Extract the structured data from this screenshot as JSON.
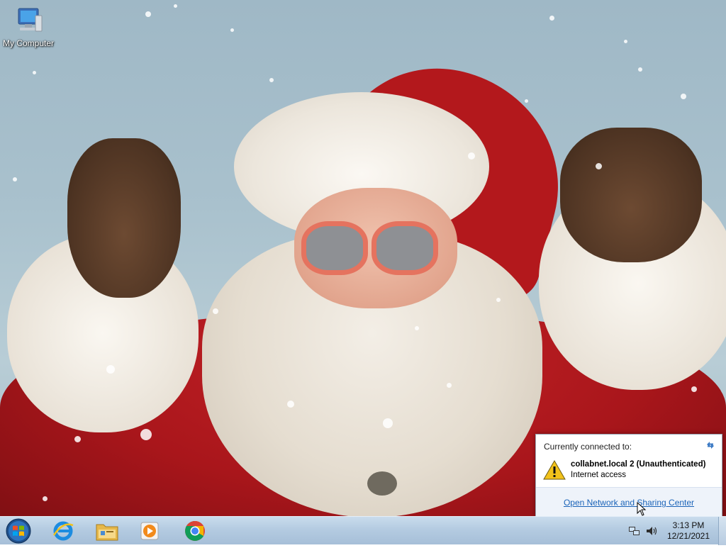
{
  "desktop": {
    "icons": [
      {
        "label": "My Computer",
        "icon": "my-computer-icon"
      }
    ],
    "wallpaper": "santa-claus-rock-gesture-snow"
  },
  "taskbar": {
    "start": {
      "icon": "windows-start-orb"
    },
    "pinned": [
      {
        "name": "Internet Explorer",
        "icon": "internet-explorer-icon"
      },
      {
        "name": "Windows Explorer",
        "icon": "file-explorer-icon"
      },
      {
        "name": "Windows Media Player",
        "icon": "media-player-icon"
      },
      {
        "name": "Google Chrome",
        "icon": "chrome-icon"
      }
    ],
    "tray": {
      "icons": [
        "network-icon",
        "volume-icon"
      ],
      "time": "3:13 PM",
      "date": "12/21/2021"
    }
  },
  "network_popup": {
    "title": "Currently connected to:",
    "network_name": "collabnet.local  2 (Unauthenticated)",
    "network_status": "Internet access",
    "link": "Open Network and Sharing Center",
    "warning_color": "#f2c21b",
    "link_color": "#1a63b8"
  }
}
